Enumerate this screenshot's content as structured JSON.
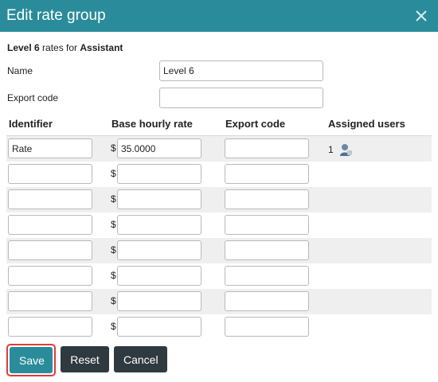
{
  "dialog": {
    "title": "Edit rate group",
    "close_icon": "close-icon"
  },
  "subtitle": {
    "level": "Level 6",
    "middle": " rates for ",
    "role": "Assistant"
  },
  "form": {
    "name_label": "Name",
    "name_value": "Level 6",
    "export_label": "Export code",
    "export_value": ""
  },
  "table": {
    "headers": {
      "identifier": "Identifier",
      "base_rate": "Base hourly rate",
      "export_code": "Export code",
      "assigned": "Assigned users"
    },
    "currency": "$",
    "rows": [
      {
        "identifier": "Rate",
        "rate": "35.0000",
        "export": "",
        "assigned": "1"
      },
      {
        "identifier": "",
        "rate": "",
        "export": "",
        "assigned": ""
      },
      {
        "identifier": "",
        "rate": "",
        "export": "",
        "assigned": ""
      },
      {
        "identifier": "",
        "rate": "",
        "export": "",
        "assigned": ""
      },
      {
        "identifier": "",
        "rate": "",
        "export": "",
        "assigned": ""
      },
      {
        "identifier": "",
        "rate": "",
        "export": "",
        "assigned": ""
      },
      {
        "identifier": "",
        "rate": "",
        "export": "",
        "assigned": ""
      },
      {
        "identifier": "",
        "rate": "",
        "export": "",
        "assigned": ""
      }
    ]
  },
  "buttons": {
    "save": "Save",
    "reset": "Reset",
    "cancel": "Cancel"
  },
  "colors": {
    "header": "#2a8c9b",
    "dark_button": "#2f3a40",
    "highlight": "#e23a3a"
  }
}
